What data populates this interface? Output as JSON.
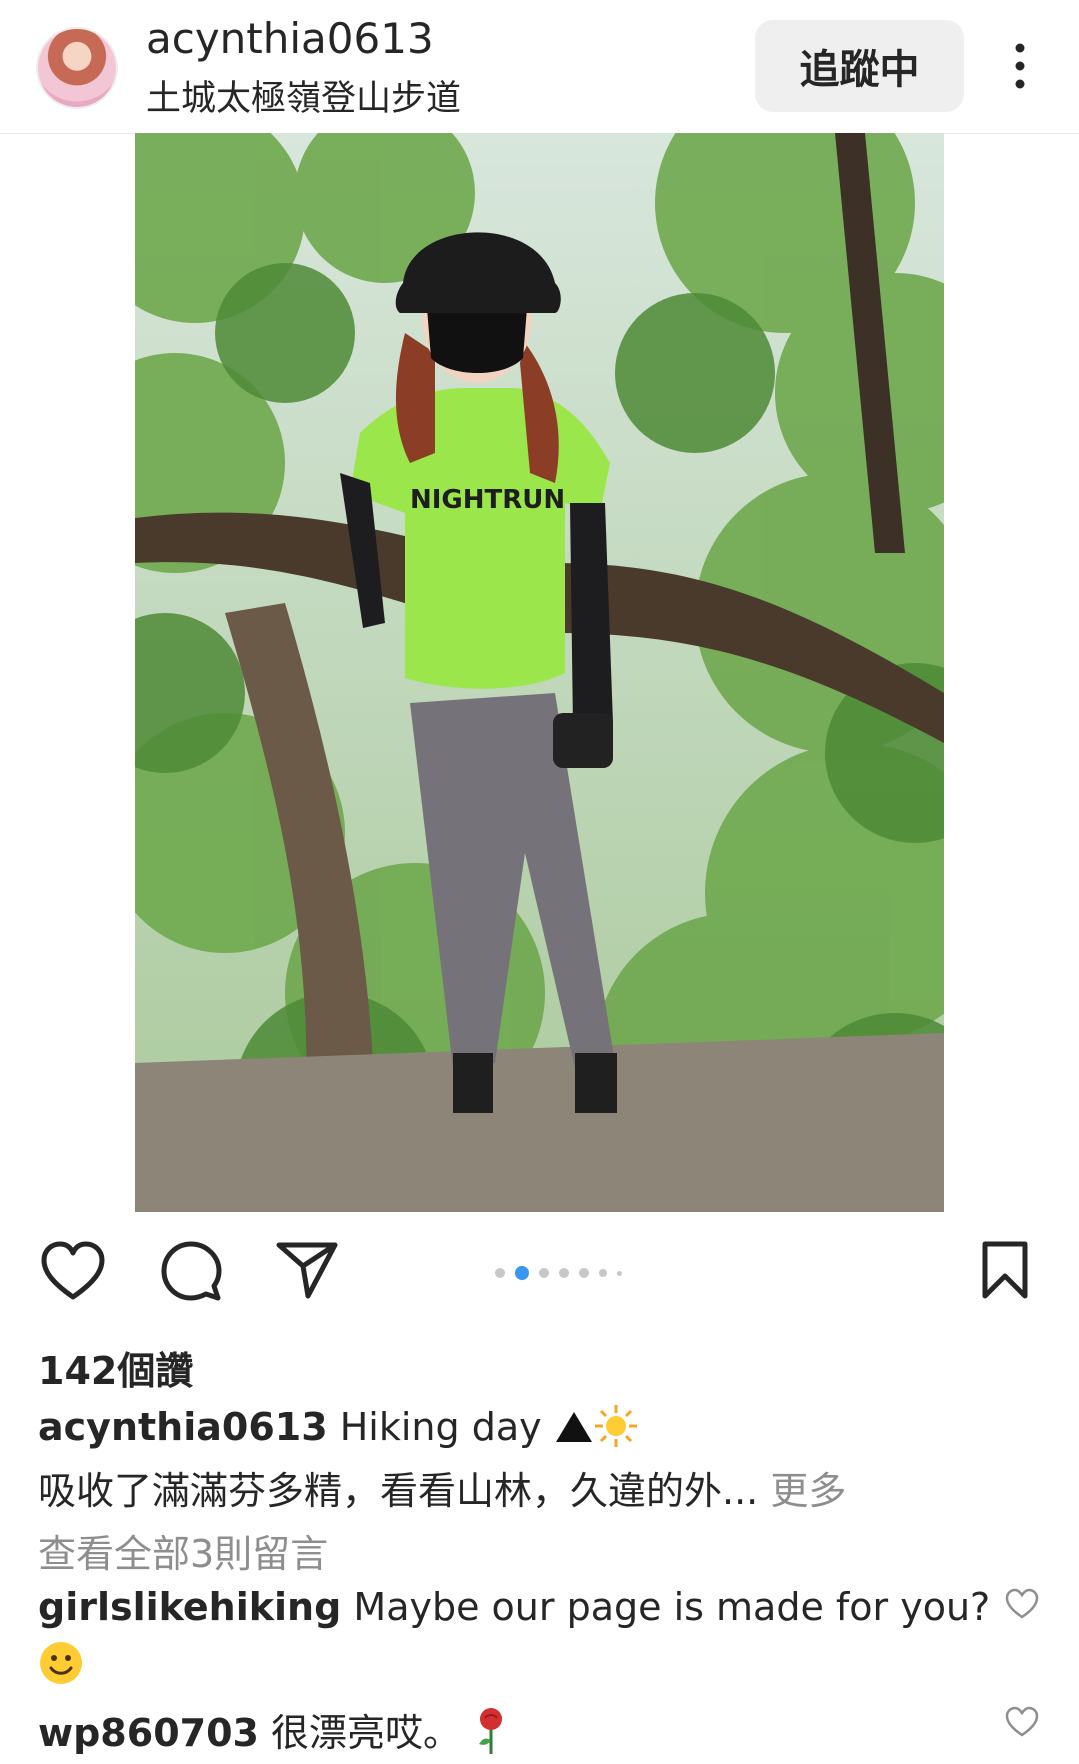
{
  "header": {
    "username": "acynthia0613",
    "location": "土城太極嶺登山步道",
    "follow_label": "追蹤中"
  },
  "post": {
    "photo_shirt_text": "NIGHTRUN",
    "carousel": {
      "count": 7,
      "active_index": 1
    }
  },
  "stats": {
    "likes_label": "142個讚"
  },
  "caption": {
    "username": "acynthia0613",
    "text": "Hiking day",
    "line2": "吸收了滿滿芬多精，看看山林，久違的外...",
    "more_label": "更多"
  },
  "comments": {
    "view_all_label": "查看全部3則留言",
    "items": [
      {
        "username": "girlslikehiking",
        "text": "Maybe our page is made for you?"
      },
      {
        "username": "wp860703",
        "text": "很漂亮哎。"
      }
    ]
  },
  "colors": {
    "accent": "#3897f0",
    "muted": "#8e8e8e",
    "text": "#262626"
  },
  "icons": [
    "more-vertical-icon",
    "heart-icon",
    "comment-icon",
    "share-icon",
    "bookmark-icon",
    "mountain-icon",
    "sun-icon",
    "smile-icon",
    "rose-icon"
  ]
}
